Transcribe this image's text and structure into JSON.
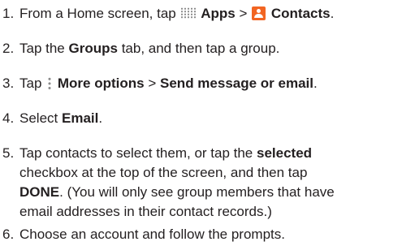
{
  "steps": [
    {
      "number": "1.",
      "text_before": "From a Home screen, tap",
      "apps_label": "Apps",
      "separator": ">",
      "contacts_label": "Contacts",
      "end": "."
    },
    {
      "number": "2.",
      "text_before": "Tap the",
      "groups_label": "Groups",
      "text_after": "tab, and then tap a group."
    },
    {
      "number": "3.",
      "text_before": "Tap",
      "more_options_label": "More options",
      "separator": ">",
      "send_label": "Send message or email",
      "end": "."
    },
    {
      "number": "4.",
      "text_before": "Select",
      "email_label": "Email",
      "end": "."
    },
    {
      "number": "5.",
      "line1_before": "Tap contacts to select them, or tap the",
      "selected_label": "selected",
      "line2": "checkbox at the top of the screen, and then tap",
      "done_label": "DONE",
      "line3_after": ". (You will only see group members that have",
      "line4": "email addresses in their contact records.)"
    },
    {
      "number": "6.",
      "text": "Choose an account and follow the prompts."
    }
  ],
  "icons": {
    "apps": "apps-grid-icon",
    "contacts": "contacts-icon",
    "more_options": "more-options-icon"
  },
  "colors": {
    "text": "#231f20",
    "contacts_icon": "#f26522",
    "icon_gray": "#8a8a8a"
  }
}
